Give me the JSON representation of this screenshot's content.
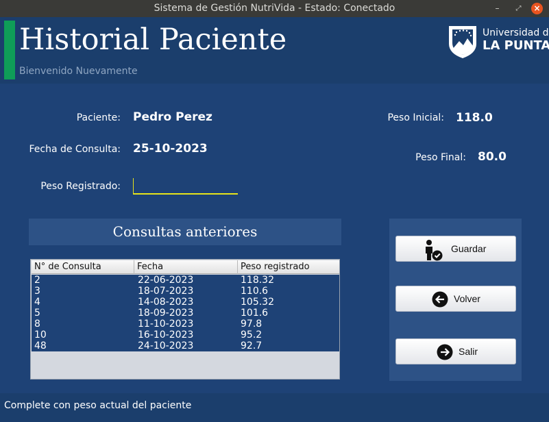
{
  "window": {
    "title": "Sistema de Gestión NutriVida - Estado: Conectado"
  },
  "header": {
    "title": "Historial Paciente",
    "subtitle": "Bienvenido Nuevamente",
    "logo_line1": "Universidad de",
    "logo_line2": "LA PUNTA"
  },
  "patient": {
    "name_label": "Paciente:",
    "name": "Pedro Perez",
    "date_label": "Fecha de Consulta:",
    "date": "25-10-2023",
    "weight_label": "Peso Registrado:",
    "weight_value": "",
    "initial_weight_label": "Peso Inicial:",
    "initial_weight": "118.0",
    "final_weight_label": "Peso Final:",
    "final_weight": "80.0"
  },
  "history": {
    "title": "Consultas anteriores",
    "columns": [
      "N° de Consulta",
      "Fecha",
      "Peso registrado"
    ],
    "rows": [
      [
        "2",
        "22-06-2023",
        "118.32"
      ],
      [
        "3",
        "18-07-2023",
        "110.6"
      ],
      [
        "4",
        "14-08-2023",
        "105.32"
      ],
      [
        "5",
        "18-09-2023",
        "101.6"
      ],
      [
        "8",
        "11-10-2023",
        "97.8"
      ],
      [
        "10",
        "16-10-2023",
        "95.2"
      ],
      [
        "48",
        "24-10-2023",
        "92.7"
      ]
    ]
  },
  "buttons": {
    "save": "Guardar",
    "back": "Volver",
    "exit": "Salir"
  },
  "status": {
    "message": "Complete con peso actual del paciente"
  },
  "colors": {
    "accent_bar": "#0f9d58",
    "input_underline": "#e8e41a",
    "background": "#1e4276"
  }
}
